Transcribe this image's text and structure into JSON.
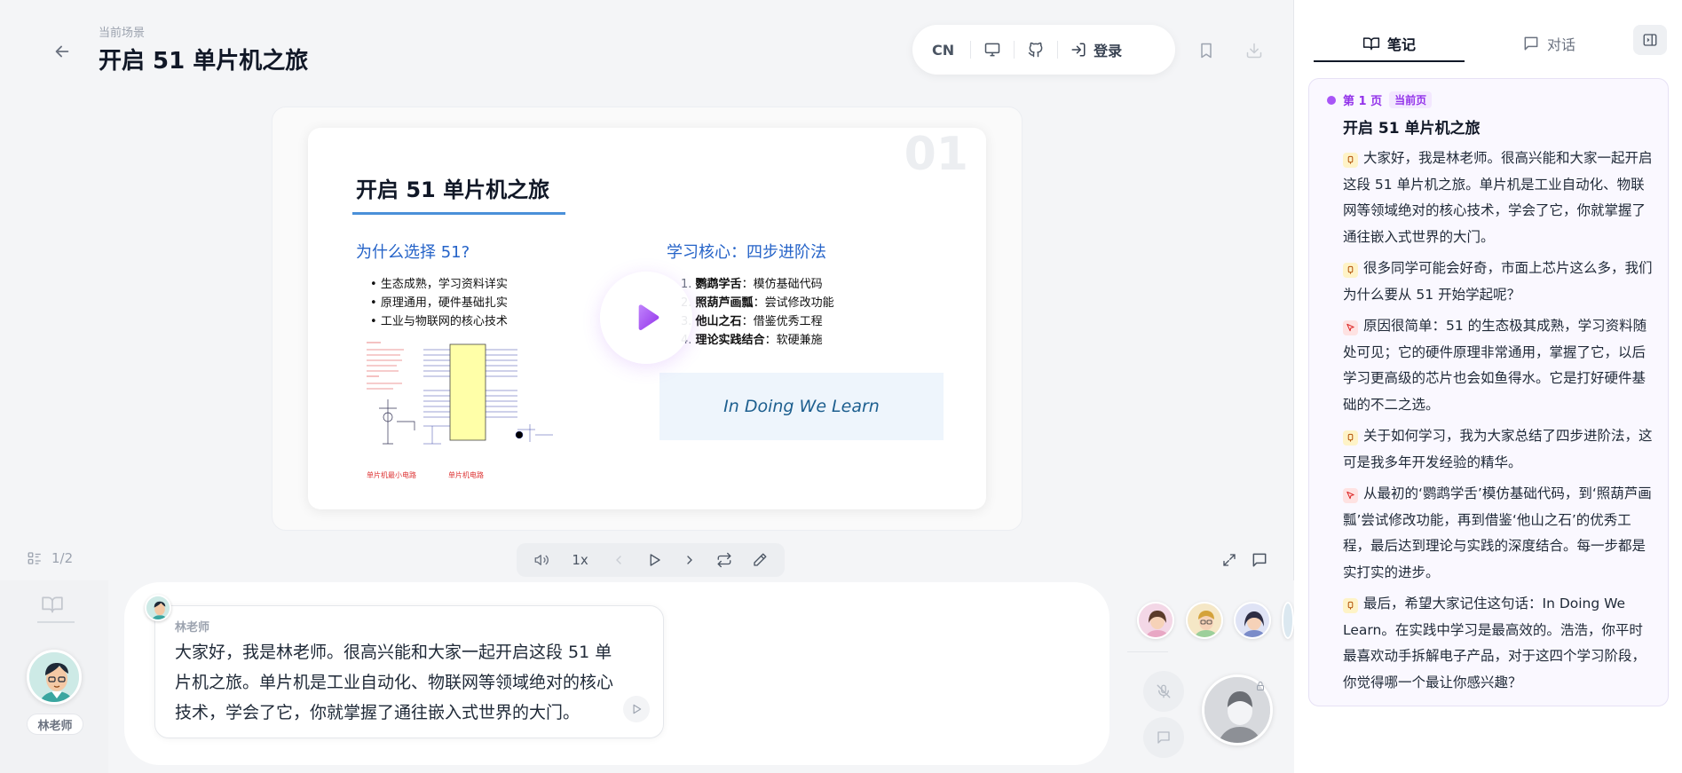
{
  "header": {
    "scene_label": "当前场景",
    "title": "开启 51 单片机之旅",
    "lang": "CN",
    "login_label": "登录"
  },
  "slide": {
    "number": "01",
    "title": "开启 51 单片机之旅",
    "left_heading": "为什么选择 51?",
    "bullets": [
      "生态成熟，学习资料详实",
      "原理通用，硬件基础扎实",
      "工业与物联网的核心技术"
    ],
    "right_heading": "学习核心：四步进阶法",
    "steps": [
      {
        "n": "1.",
        "name": "鹦鹉学舌",
        "desc": "：模仿基础代码"
      },
      {
        "n": "2.",
        "name": "照葫芦画瓢",
        "desc": "：尝试修改功能"
      },
      {
        "n": "3.",
        "name": "他山之石",
        "desc": "：借鉴优秀工程"
      },
      {
        "n": "4.",
        "name": "理论实践结合",
        "desc": "：软硬兼施"
      }
    ],
    "motto": "In Doing We Learn",
    "circuit_labels": {
      "left": "单片机最小电路",
      "right": "单片机电路"
    }
  },
  "controls": {
    "page_indicator": "1/2",
    "speed": "1x"
  },
  "chat": {
    "teacher_name": "林老师",
    "speaker": "林老师",
    "message": "大家好，我是林老师。很高兴能和大家一起开启这段 51 单片机之旅。单片机是工业自动化、物联网等领域绝对的核心技术，学会了它，你就掌握了通往嵌入式世界的大门。"
  },
  "panel": {
    "tabs": [
      "笔记",
      "对话"
    ],
    "page_label": "第 1 页",
    "current_badge": "当前页",
    "note_title": "开启 51 单片机之旅",
    "notes": [
      {
        "icon": "speech",
        "text": "大家好，我是林老师。很高兴能和大家一起开启这段 51 单片机之旅。单片机是工业自动化、物联网等领域绝对的核心技术，学会了它，你就掌握了通往嵌入式世界的大门。"
      },
      {
        "icon": "speech",
        "text": "很多同学可能会好奇，市面上芯片这么多，我们为什么要从 51 开始学起呢？"
      },
      {
        "icon": "cursor",
        "text": "原因很简单：51 的生态极其成熟，学习资料随处可见；它的硬件原理非常通用，掌握了它，以后学习更高级的芯片也会如鱼得水。它是打好硬件基础的不二之选。"
      },
      {
        "icon": "speech",
        "text": "关于如何学习，我为大家总结了四步进阶法，这可是我多年开发经验的精华。"
      },
      {
        "icon": "cursor",
        "text": "从最初的‘鹦鹉学舌’模仿基础代码，到‘照葫芦画瓢’尝试修改功能，再到借鉴‘他山之石’的优秀工程，最后达到理论与实践的深度结合。每一步都是实打实的进步。"
      },
      {
        "icon": "speech",
        "text": "最后，希望大家记住这句话：In Doing We Learn。在实践中学习是最高效的。浩浩，你平时最喜欢动手拆解电子产品，对于这四个学习阶段，你觉得哪一个最让你感兴趣？"
      }
    ]
  },
  "colors": {
    "accent": "#a855f7",
    "heading_blue": "#2563c8",
    "motto_bg": "#eef5fc"
  }
}
